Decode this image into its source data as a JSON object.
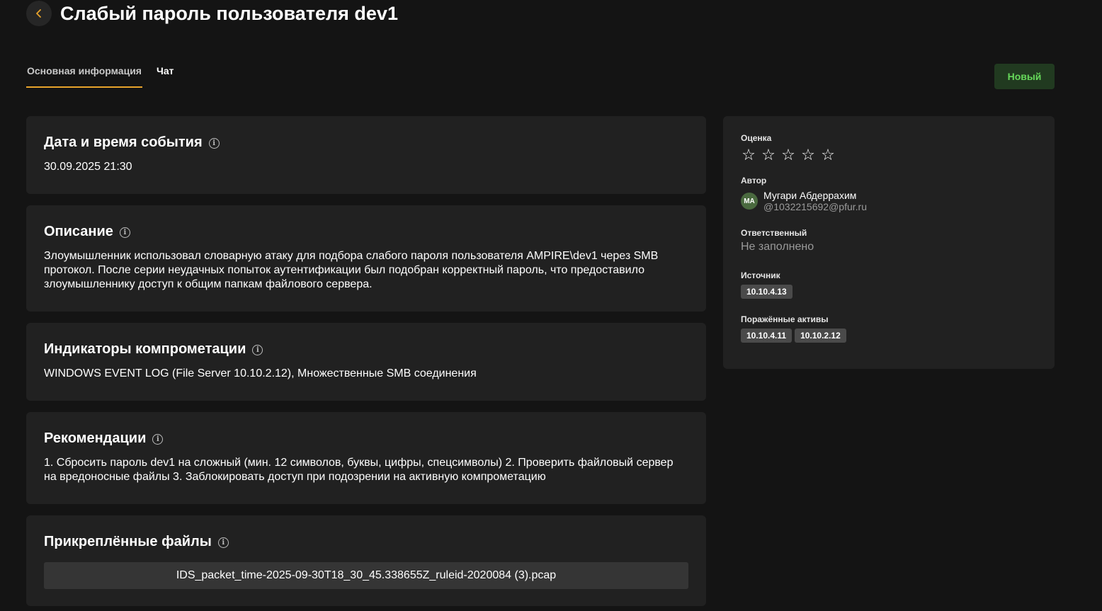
{
  "header": {
    "title": "Слабый пароль пользователя dev1",
    "back_icon": "chevron-left-icon",
    "accent_color": "#e8a32b"
  },
  "tabs": [
    {
      "label": "Основная информация",
      "active": true
    },
    {
      "label": "Чат",
      "active": false
    }
  ],
  "status": {
    "label": "Новый",
    "color": "#66d85a",
    "background": "#213a20"
  },
  "sections": {
    "datetime": {
      "title": "Дата и время события",
      "value": "30.09.2025 21:30"
    },
    "description": {
      "title": "Описание",
      "text": "Злоумышленник использовал словарную атаку для подбора слабого пароля пользователя AMPIRE\\dev1 через SMB протокол. После серии неудачных попыток аутентификации был подобран корректный пароль, что предоставило злоумышленнику доступ к общим папкам файлового сервера."
    },
    "indicators": {
      "title": "Индикаторы компрометации",
      "text": "WINDOWS EVENT LOG (File Server 10.10.2.12), Множественные SMB соединения"
    },
    "recommendations": {
      "title": "Рекомендации",
      "text": "1. Сбросить пароль dev1 на сложный (мин. 12 символов, буквы, цифры, спецсимволы) 2. Проверить файловый сервер на вредоносные файлы 3. Заблокировать доступ при подозрении на активную компрометацию"
    },
    "files": {
      "title": "Прикреплённые файлы",
      "items": [
        "IDS_packet_time-2025-09-30T18_30_45.338655Z_ruleid-2020084 (3).pcap"
      ]
    }
  },
  "side": {
    "rating_label": "Оценка",
    "rating_value": 0,
    "rating_max": 5,
    "star_icon": "star-outline-icon",
    "author_label": "Автор",
    "author_initials": "MA",
    "author_name": "Мугари Абдеррахим",
    "author_email": "@1032215692@pfur.ru",
    "responsible_label": "Ответственный",
    "responsible_value": "Не заполнено",
    "source_label": "Источник",
    "source_ips": [
      "10.10.4.13"
    ],
    "affected_label": "Поражённые активы",
    "affected_ips": [
      "10.10.4.11",
      "10.10.2.12"
    ]
  }
}
